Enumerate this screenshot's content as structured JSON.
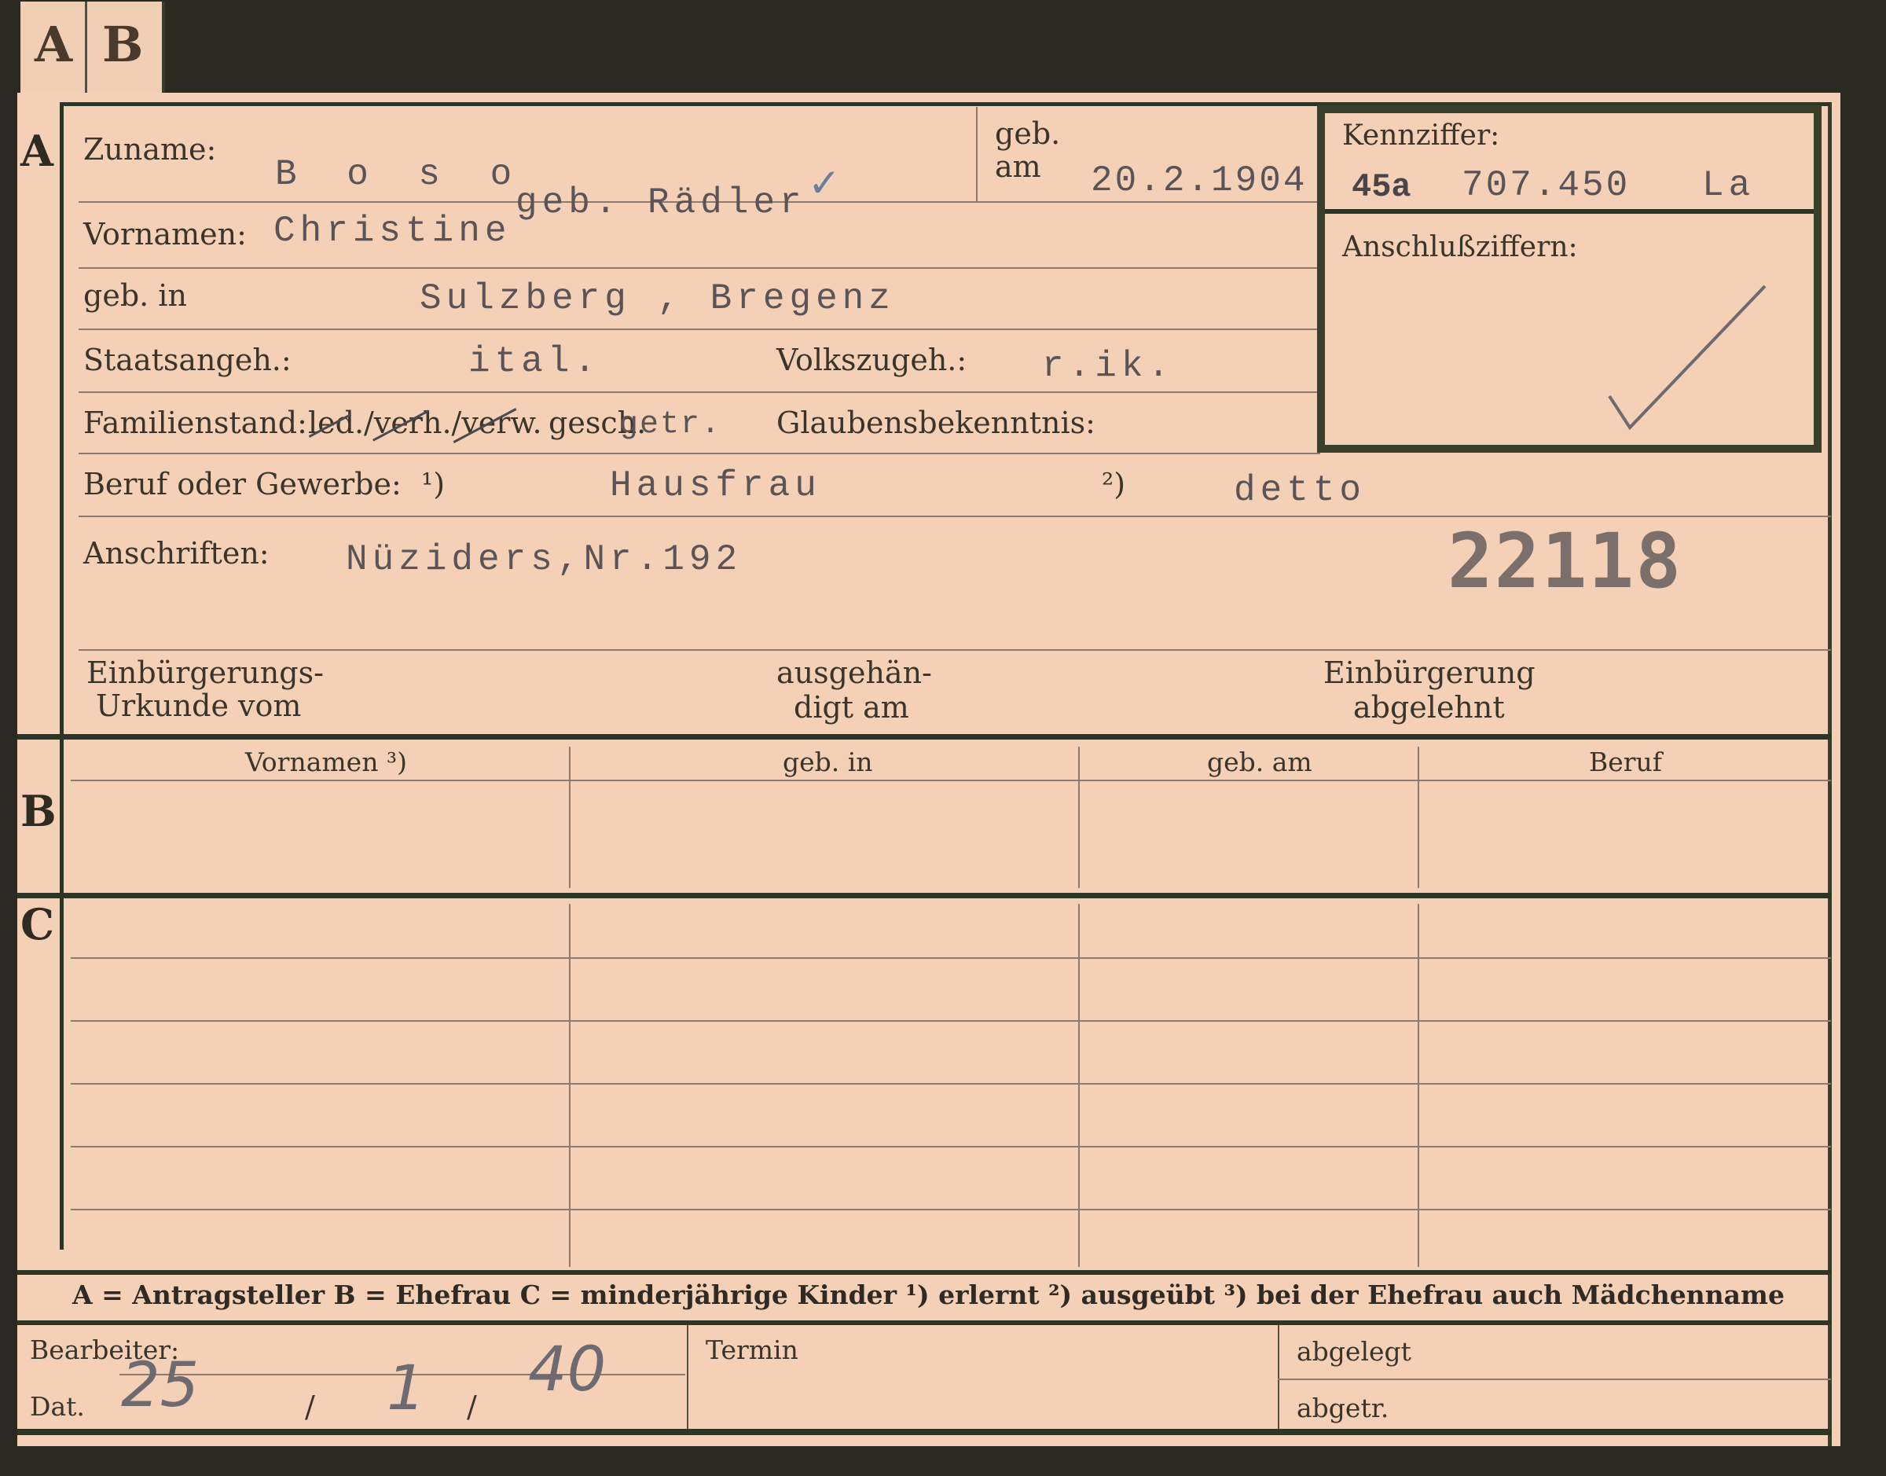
{
  "tabs": [
    "A",
    "B"
  ],
  "section_markers": {
    "a": "A",
    "b": "B",
    "c": "C"
  },
  "section_a": {
    "zuname_label": "Zuname:",
    "zuname_value": "B o s o",
    "geb_name_value": "geb. Rädler",
    "geb_am_label_1": "geb.",
    "geb_am_label_2": "am",
    "geb_am_value": "20.2.1904",
    "vornamen_label": "Vornamen:",
    "vornamen_value": "Christine",
    "geb_in_label": "geb. in",
    "geb_in_value": "Sulzberg , Bregenz",
    "staatsangeh_label": "Staatsangeh.:",
    "staatsangeh_value": "ital.",
    "volkszugeh_label": "Volkszugeh.:",
    "volkszugeh_value": "r.ik.",
    "familienstand_label": "Familienstand:",
    "familienstand_options": "led./verh./verw.",
    "familienstand_value": "gesch.",
    "familienstand_typed": "getr.",
    "glaubensbekenntnis_label": "Glaubensbekenntnis:",
    "beruf_label": "Beruf oder Gewerbe:",
    "beruf_note1": "¹)",
    "beruf_value": "Hausfrau",
    "beruf_note2": "²)",
    "beruf_value2": "detto",
    "anschriften_label": "Anschriften:",
    "anschriften_value": "Nüziders,Nr.192",
    "record_number": "22118",
    "einbuergerung_label_1": "Einbürgerungs-",
    "einbuergerung_label_2": "Urkunde vom",
    "ausgehaendigt_label_1": "ausgehän-",
    "ausgehaendigt_label_2": "digt am",
    "abgelehnt_label_1": "Einbürgerung",
    "abgelehnt_label_2": "abgelehnt"
  },
  "kennziffer": {
    "label": "Kennziffer:",
    "prefix": "45a",
    "value": "707.450",
    "suffix": "La",
    "anschluss_label": "Anschlußziffern:"
  },
  "section_b": {
    "columns": [
      "Vornamen ³)",
      "geb. in",
      "geb. am",
      "Beruf"
    ]
  },
  "legend": {
    "text": "A = Antragsteller   B = Ehefrau   C = minderjährige Kinder   ¹) erlernt   ²) ausgeübt   ³) bei der Ehefrau auch Mädchenname"
  },
  "footer": {
    "bearbeiter_label": "Bearbeiter:",
    "dat_label": "Dat.",
    "date_day": "25",
    "date_sep": "/",
    "date_month": "1",
    "date_year": "40",
    "termin_label": "Termin",
    "abgelegt_label": "abgelegt",
    "abgetr_label": "abgetr."
  }
}
